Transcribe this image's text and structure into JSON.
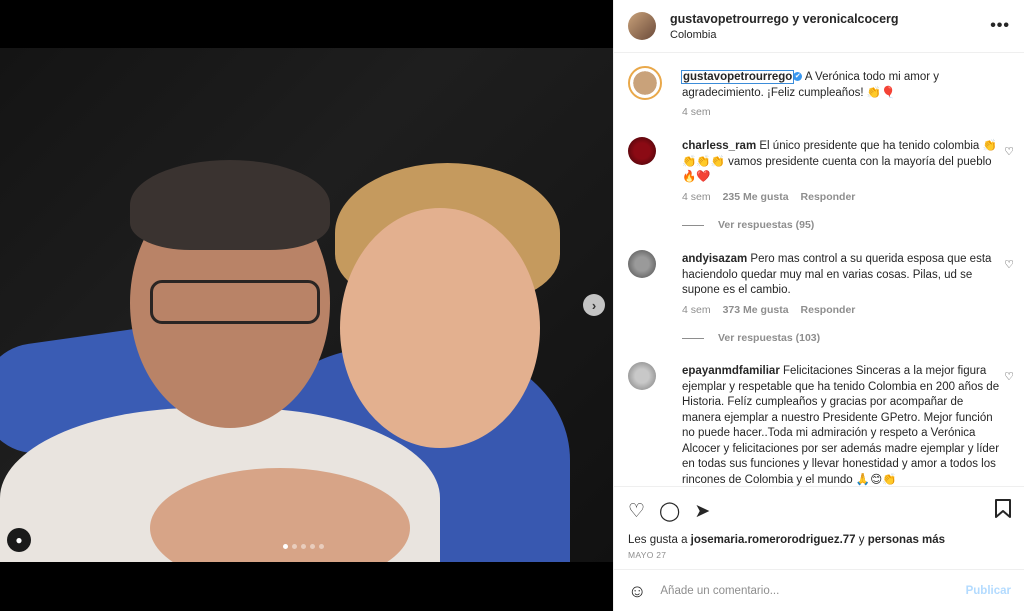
{
  "header": {
    "users": "gustavopetrourrego y veronicalcocerg",
    "location": "Colombia",
    "more": "•••"
  },
  "media": {
    "next": "›",
    "user_tag_icon": "person-icon",
    "slide_count": 5
  },
  "caption": {
    "username": "gustavopetrourrego",
    "verified_icon": "✔",
    "text": "A Verónica todo mi amor y agradecimiento. ¡Feliz cumpleaños! 👏🎈",
    "time": "4 sem"
  },
  "comments": [
    {
      "username": "charless_ram",
      "text": "El único presidente que ha tenido colombia 👏👏👏👏 vamos presidente cuenta con la mayoría del pueblo 🔥❤️",
      "time": "4 sem",
      "likes": "235 Me gusta",
      "reply": "Responder",
      "view_replies": "Ver respuestas (95)"
    },
    {
      "username": "andyisazam",
      "text": "Pero mas control a su querida esposa que esta haciendolo quedar muy mal en varias cosas. Pilas, ud se supone es el cambio.",
      "time": "4 sem",
      "likes": "373 Me gusta",
      "reply": "Responder",
      "view_replies": "Ver respuestas (103)"
    },
    {
      "username": "epayanmdfamiliar",
      "text": "Felicitaciones Sinceras a la mejor figura ejemplar y respetable que ha tenido Colombia en 200 años de Historia. Felíz cumpleaños y gracias por acompañar de manera ejemplar a nuestro Presidente GPetro. Mejor función no puede hacer..Toda mi admiración y respeto a Verónica Alcocer y felicitaciones por ser además madre ejemplar y líder en todas sus funciones y llevar honestidad y amor a todos los rincones de Colombia y el mundo 🙏😊👏"
    }
  ],
  "actions": {
    "like": "♡",
    "comment": "◯",
    "share": "➤",
    "save": "🔖"
  },
  "likes": {
    "prefix": "Les gusta a",
    "user": "josemaria.romerorodriguez.77",
    "suffix": "y",
    "others": "personas más"
  },
  "date": "MAYO 27",
  "add_comment": {
    "placeholder": "Añade un comentario...",
    "post": "Publicar"
  }
}
